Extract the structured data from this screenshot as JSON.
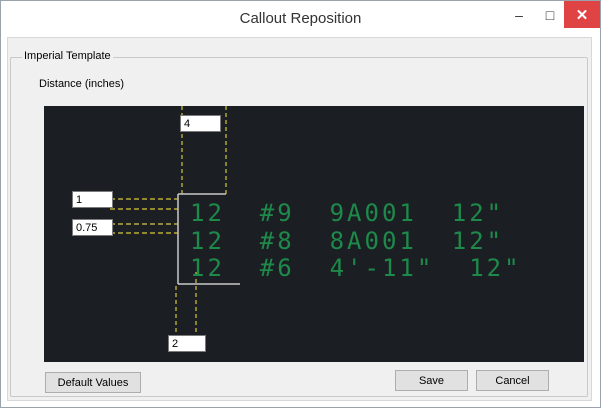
{
  "window": {
    "title": "Callout Reposition",
    "minimize_glyph": "–",
    "maximize_glyph": "□",
    "close_glyph": "✕"
  },
  "group": {
    "label": "Imperial Template",
    "distance_label": "Distance (inches)"
  },
  "fields": {
    "top": "4",
    "left_top": "1",
    "left_bottom": "0.75",
    "bottom": "2"
  },
  "callouts": [
    "12  #9  9A001  12\"",
    "12  #8  8A001  12\"",
    "12  #6  4'-11\"  12\""
  ],
  "buttons": {
    "default": "Default Values",
    "save": "Save",
    "cancel": "Cancel"
  },
  "colors": {
    "canvas_bg": "#1b1f24",
    "callout_text": "#1e8a4a",
    "guide_dashes": "#d6c63a",
    "leader_lines": "#c8c8c8",
    "close_button": "#e04343"
  }
}
